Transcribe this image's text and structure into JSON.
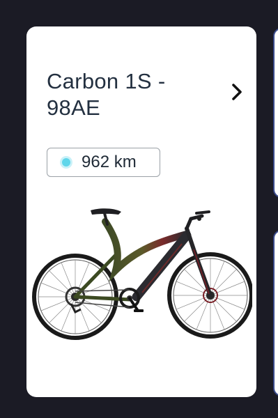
{
  "bike_card": {
    "title": "Carbon 1S - 98AE",
    "distance": "962 km",
    "chevron_icon": "chevron-right-icon",
    "status_dot_icon": "status-dot-icon",
    "colors": {
      "card_bg": "#ffffff",
      "page_bg": "#1b1b25",
      "title": "#233040",
      "status_dot": "#5ed6ea",
      "pill_border": "#9aa0a6"
    }
  }
}
